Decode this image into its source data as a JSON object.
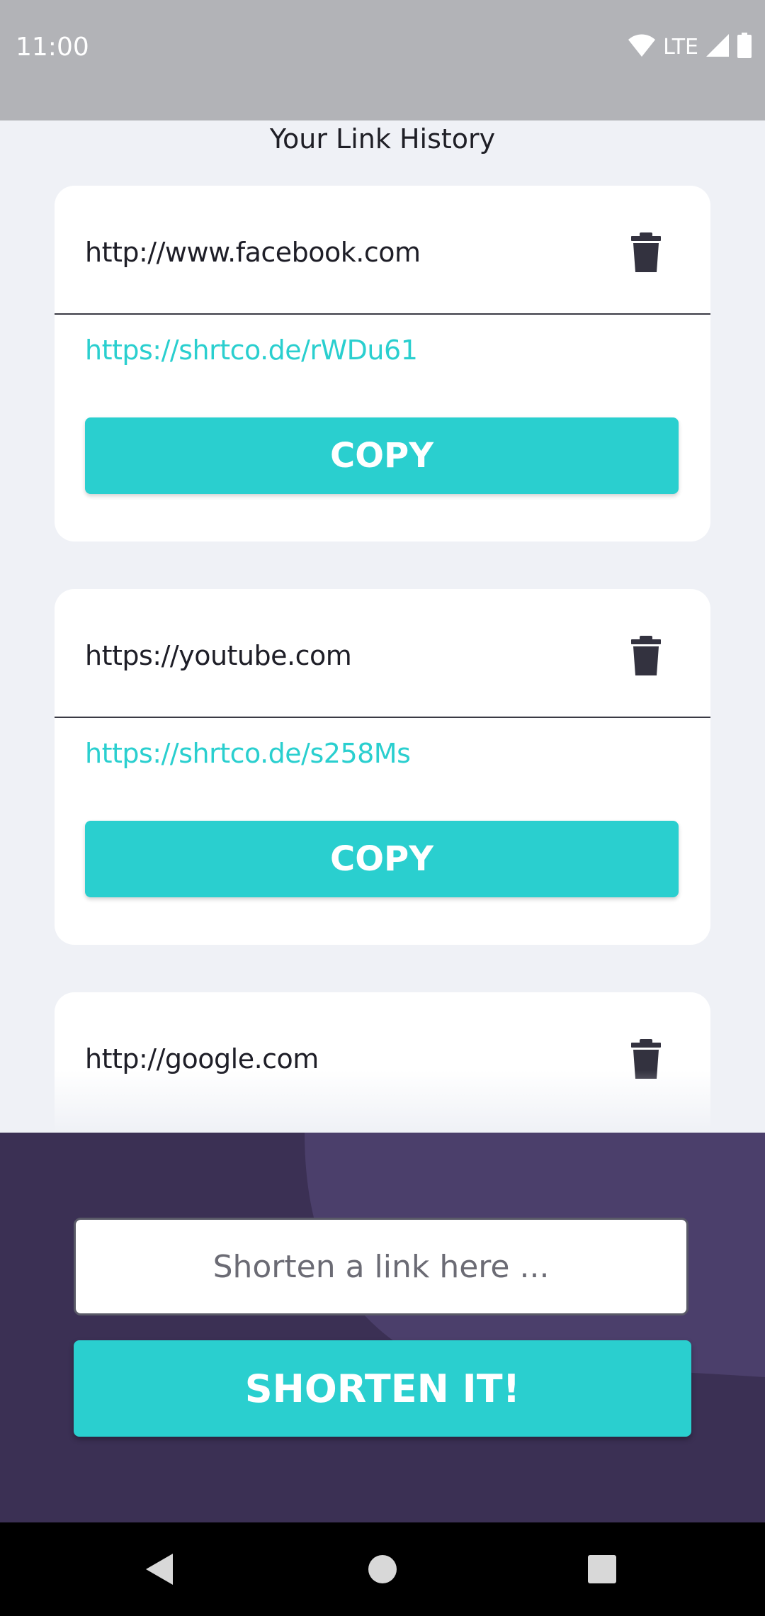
{
  "status_bar": {
    "time": "11:00",
    "network": "LTE",
    "icons": [
      "wifi-icon",
      "cellular-signal-icon",
      "battery-icon"
    ]
  },
  "history": {
    "title": "Your Link History",
    "items": [
      {
        "original": "http://www.facebook.com",
        "short": "https://shrtco.de/rWDu61",
        "copy_label": "COPY"
      },
      {
        "original": "https://youtube.com",
        "short": "https://shrtco.de/s258Ms",
        "copy_label": "COPY"
      },
      {
        "original": "http://google.com"
      }
    ]
  },
  "shorten_form": {
    "placeholder": "Shorten a link here ...",
    "button_label": "SHORTEN IT!"
  },
  "navigation": {
    "buttons": [
      "back-icon",
      "home-icon",
      "recents-icon"
    ]
  },
  "colors": {
    "accent": "#2ACFCF",
    "panel": "#3B3054",
    "panel_shape": "#4B3F6B",
    "background": "#EFF1F6",
    "status_bar": "#B2B3B7"
  }
}
